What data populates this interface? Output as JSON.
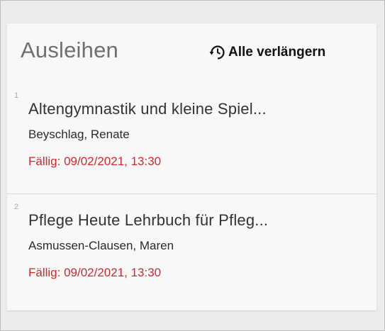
{
  "loans_panel": {
    "title": "Ausleihen",
    "renew_all_label": "Alle verlängern",
    "renew_icon": "clock-renew-icon",
    "accent_color": "#d6262b",
    "items": [
      {
        "index": "1",
        "title": "Altengymnastik und kleine Spiel...",
        "author": "Beyschlag, Renate",
        "due": "Fällig: 09/02/2021, 13:30"
      },
      {
        "index": "2",
        "title": "Pflege Heute Lehrbuch für Pfleg...",
        "author": "Asmussen-Clausen, Maren",
        "due": "Fällig: 09/02/2021, 13:30"
      }
    ]
  }
}
